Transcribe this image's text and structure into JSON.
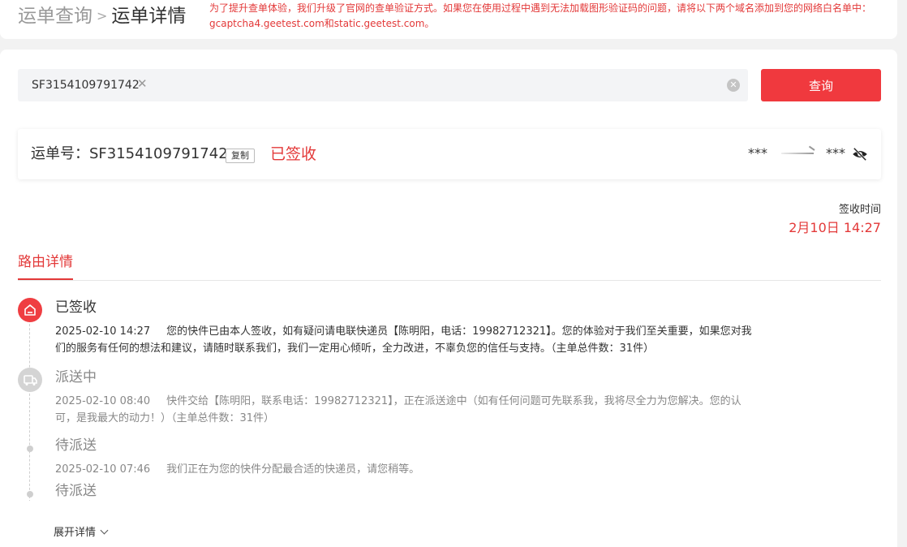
{
  "breadcrumb": {
    "parent": "运单查询",
    "separator": ">",
    "current": "运单详情"
  },
  "notice": "为了提升查单体验，我们升级了官网的查单验证方式。如果您在使用过程中遇到无法加载图形验证码的问题，请将以下两个域名添加到您的网络白名单中：gcaptcha4.geetest.com和static.geetest.com。",
  "search": {
    "tag": "SF3154109791742",
    "query_label": "查询"
  },
  "waybill": {
    "label": "运单号：SF3154109791742",
    "copy_label": "复制",
    "status": "已签收",
    "from": "***",
    "to": "***"
  },
  "sign": {
    "label": "签收时间",
    "time": "2月10日 14:27"
  },
  "route_tab": "路由详情",
  "timeline": [
    {
      "title": "已签收",
      "time": "2025-02-10 14:27",
      "desc": "您的快件已由本人签收，如有疑问请电联快递员【陈明阳，电话：19982712321】。您的体验对于我们至关重要，如果您对我们的服务有任何的想法和建议，请随时联系我们，我们一定用心倾听，全力改进，不辜负您的信任与支持。（主单总件数：31件）"
    },
    {
      "title": "派送中",
      "time": "2025-02-10 08:40",
      "desc": "快件交给【陈明阳，联系电话：19982712321】，正在派送途中（如有任何问题可先联系我，我将尽全力为您解决。您的认可，是我最大的动力！）（主单总件数：31件）"
    },
    {
      "title": "待派送",
      "time": "2025-02-10 07:46",
      "desc": "我们正在为您的快件分配最合适的快递员，请您稍等。"
    },
    {
      "title": "待派送",
      "time": "",
      "desc": ""
    }
  ],
  "expand_label": "展开详情",
  "colors": {
    "accent": "#e33939",
    "button": "#f0393e"
  }
}
